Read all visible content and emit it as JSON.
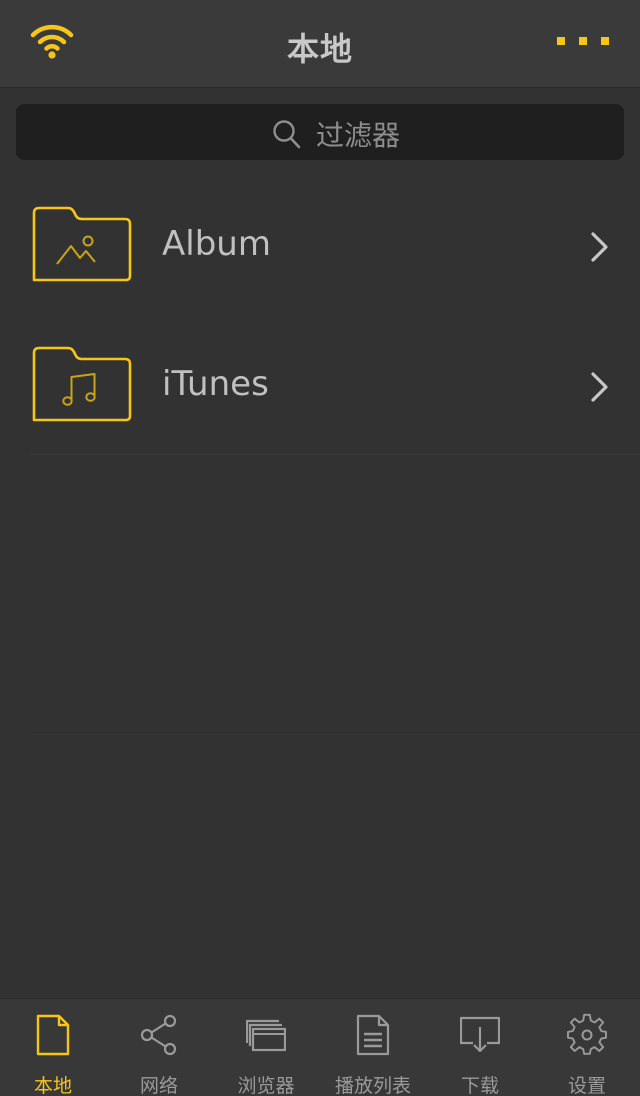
{
  "colors": {
    "accent": "#f5c518",
    "background": "#323232",
    "header": "#3a3a3a",
    "search_bg": "#1f1f20",
    "text": "#c0c0c0",
    "inactive": "#9a9a9a"
  },
  "header": {
    "title": "本地",
    "left_icon": "wifi-icon",
    "right_icon": "more-icon"
  },
  "search": {
    "placeholder": "过滤器",
    "icon": "search-icon"
  },
  "list": {
    "items": [
      {
        "label": "Album",
        "icon": "folder-image-icon"
      },
      {
        "label": "iTunes",
        "icon": "folder-music-icon"
      }
    ]
  },
  "tabbar": {
    "active_index": 0,
    "tabs": [
      {
        "label": "本地",
        "icon": "document-icon"
      },
      {
        "label": "网络",
        "icon": "share-icon"
      },
      {
        "label": "浏览器",
        "icon": "browser-windows-icon"
      },
      {
        "label": "播放列表",
        "icon": "playlist-document-icon"
      },
      {
        "label": "下载",
        "icon": "download-tray-icon"
      },
      {
        "label": "设置",
        "icon": "gear-icon"
      }
    ]
  }
}
